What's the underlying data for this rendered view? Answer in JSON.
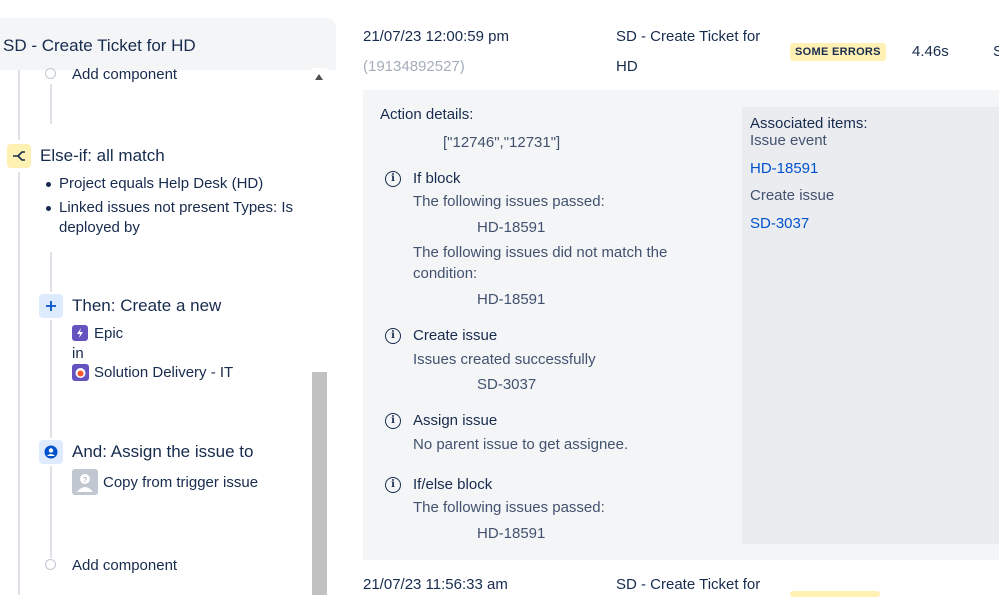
{
  "rule": {
    "title": "SD - Create Ticket for HD",
    "add_component_top": "Add component",
    "else_if": {
      "label": "Else-if: all match",
      "conditions": [
        "Project equals Help Desk (HD)",
        "Linked issues not present Types: Is",
        "deployed by"
      ]
    },
    "then": {
      "label": "Then: Create a new",
      "issue_type": "Epic",
      "in_label": "in",
      "project": "Solution Delivery - IT"
    },
    "and": {
      "label": "And: Assign the issue to",
      "value": "Copy from trigger issue"
    },
    "add_component_bottom": "Add component"
  },
  "audit_log": {
    "entry1": {
      "date": "21/07/23 12:00:59 pm",
      "id": "(19134892527)",
      "rule_line1": "SD - Create Ticket for",
      "rule_line2": "HD",
      "status": "SOME ERRORS",
      "duration": "4.46s",
      "cut_text": "S"
    },
    "details": {
      "heading": "Action details:",
      "ids": "[\"12746\",\"12731\"]",
      "blocks": [
        {
          "title": "If block",
          "lines": [
            "The following issues passed:",
            "HD-18591",
            "The following issues did not match the",
            "condition:",
            "HD-18591"
          ]
        },
        {
          "title": "Create issue",
          "lines": [
            "Issues created successfully",
            "SD-3037"
          ]
        },
        {
          "title": "Assign issue",
          "lines": [
            "No parent issue to get assignee."
          ]
        },
        {
          "title": "If/else block",
          "lines": [
            "The following issues passed:",
            "HD-18591"
          ]
        }
      ]
    },
    "associated": {
      "heading": "Associated items:",
      "groups": [
        {
          "label": "Issue event",
          "link": "HD-18591"
        },
        {
          "label": "Create issue",
          "link": "SD-3037"
        }
      ]
    },
    "entry2": {
      "date": "21/07/23 11:56:33 am",
      "rule_line1": "SD - Create Ticket for"
    }
  },
  "colors": {
    "accent_link": "#0052cc",
    "badge_bg": "#fff0b3",
    "else_if_icon_bg": "#fff0b3",
    "then_icon_bg": "#deebff",
    "epic_purple": "#6554c0"
  }
}
